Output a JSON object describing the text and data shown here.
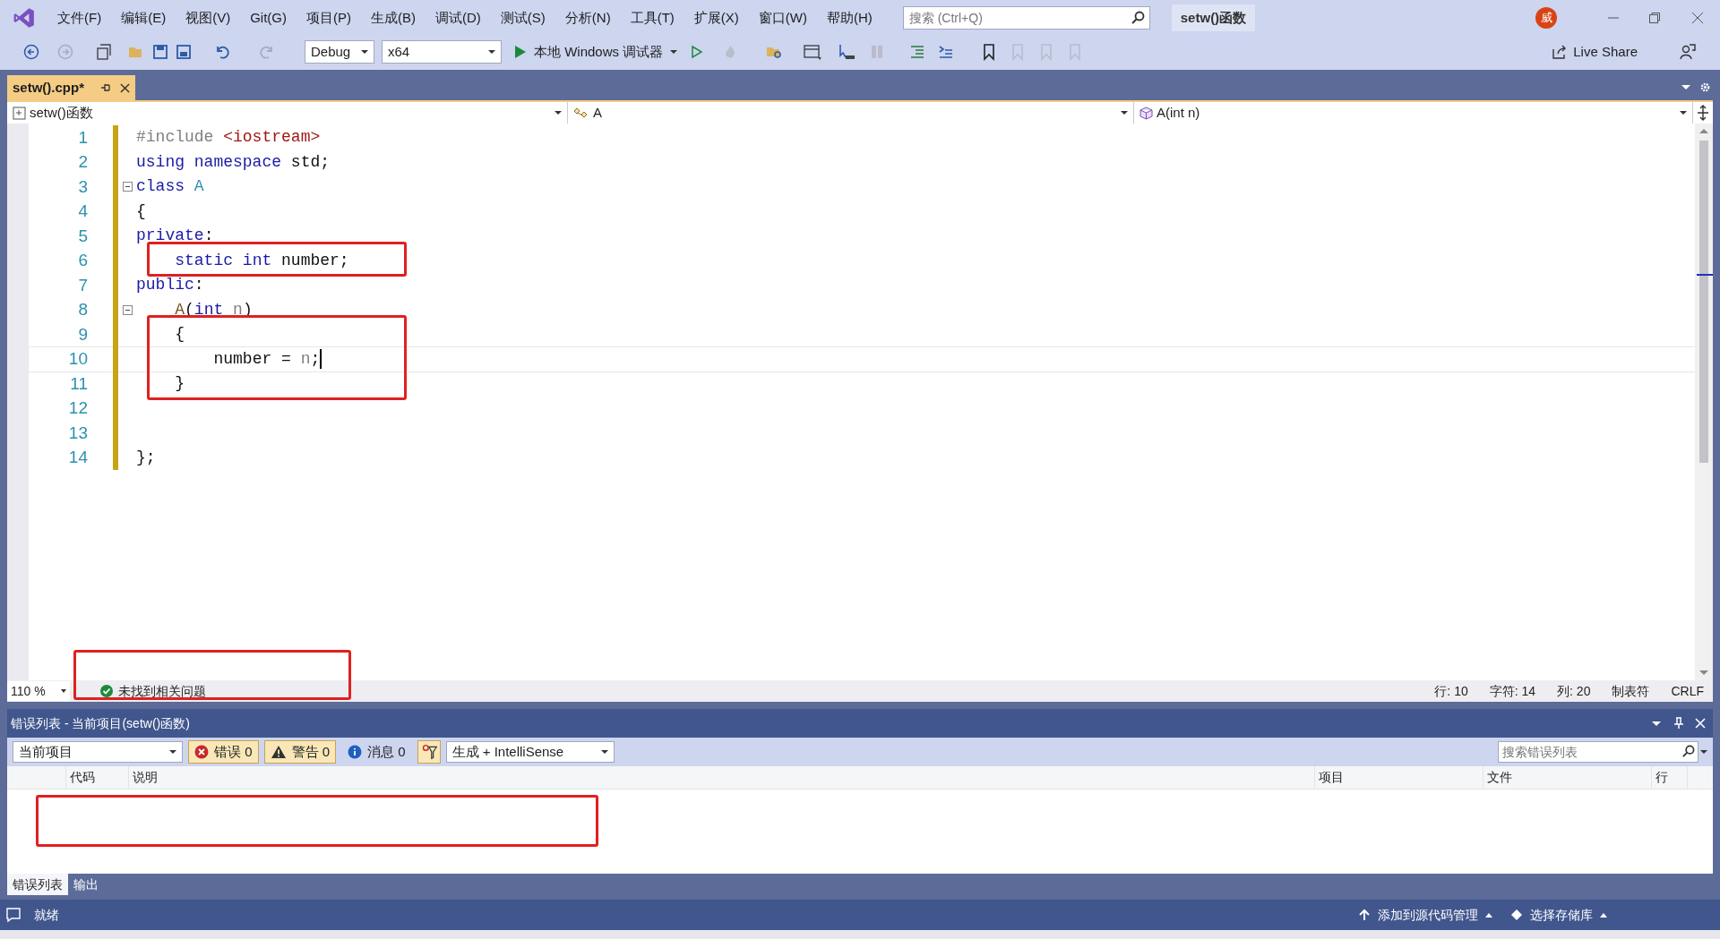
{
  "title_bar": {
    "menu": [
      "文件(F)",
      "编辑(E)",
      "视图(V)",
      "Git(G)",
      "项目(P)",
      "生成(B)",
      "调试(D)",
      "测试(S)",
      "分析(N)",
      "工具(T)",
      "扩展(X)",
      "窗口(W)",
      "帮助(H)"
    ],
    "search": {
      "placeholder": "搜索 (Ctrl+Q)"
    },
    "solution_name": "setw()函数",
    "avatar": "威"
  },
  "toolbar": {
    "configuration": "Debug",
    "platform": "x64",
    "run": "本地 Windows 调试器",
    "live_share": "Live Share"
  },
  "document_tabs": [
    {
      "label": "setw().cpp*",
      "selected": true
    }
  ],
  "nav_bar": [
    "setw()函数",
    "A",
    "A(int n)"
  ],
  "code_lines": [
    {
      "number": "1",
      "tokens": [
        {
          "kind": "preproc",
          "text": "#include "
        },
        {
          "kind": "string",
          "text": "<iostream>"
        }
      ]
    },
    {
      "number": "2",
      "tokens": [
        {
          "kind": "keyword",
          "text": "using namespace"
        },
        {
          "kind": "plain",
          "text": " std;"
        }
      ]
    },
    {
      "number": "3",
      "fold": true,
      "tokens": [
        {
          "kind": "keyword",
          "text": "class "
        },
        {
          "kind": "type",
          "text": "A"
        }
      ]
    },
    {
      "number": "4",
      "tokens": [
        {
          "kind": "plain",
          "text": "{"
        }
      ]
    },
    {
      "number": "5",
      "tokens": [
        {
          "kind": "keyword",
          "text": "private"
        },
        {
          "kind": "plain",
          "text": ":"
        }
      ]
    },
    {
      "number": "6",
      "marked": true,
      "tokens": [
        {
          "kind": "keyword",
          "text": "    static int"
        },
        {
          "kind": "plain",
          "text": " number;"
        }
      ]
    },
    {
      "number": "7",
      "tokens": [
        {
          "kind": "keyword",
          "text": "public"
        },
        {
          "kind": "plain",
          "text": ":"
        }
      ]
    },
    {
      "number": "8",
      "fold": true,
      "tokens": [
        {
          "kind": "function",
          "text": "    A"
        },
        {
          "kind": "plain",
          "text": "("
        },
        {
          "kind": "keyword",
          "text": "int "
        },
        {
          "kind": "param",
          "text": "n"
        },
        {
          "kind": "plain",
          "text": ")"
        }
      ]
    },
    {
      "number": "9",
      "marked": true,
      "tokens": [
        {
          "kind": "plain",
          "text": "    {"
        }
      ]
    },
    {
      "number": "10",
      "marked": true,
      "cursor": true,
      "tokens": [
        {
          "kind": "plain",
          "text": "        number = "
        },
        {
          "kind": "param",
          "text": "n"
        },
        {
          "kind": "plain",
          "text": ";"
        }
      ]
    },
    {
      "number": "11",
      "marked": true,
      "tokens": [
        {
          "kind": "plain",
          "text": "    }"
        }
      ]
    },
    {
      "number": "12"
    },
    {
      "number": "13"
    },
    {
      "number": "14",
      "tokens": [
        {
          "kind": "plain",
          "text": "};"
        }
      ]
    }
  ],
  "editor_status": {
    "zoom": "110 %",
    "issues": "未找到相关问题",
    "issues_marked": true,
    "line": "行: 10",
    "char": "字符: 14",
    "col": "列: 20",
    "tabs": "制表符",
    "eol": "CRLF"
  },
  "error_list": {
    "title": "错误列表 - 当前项目(setw()函数)",
    "scope": "当前项目",
    "filters": [
      {
        "kind": "error",
        "label": "错误 0",
        "on": true
      },
      {
        "kind": "warning",
        "label": "警告 0",
        "on": true
      },
      {
        "kind": "info",
        "label": "消息 0",
        "on": false
      }
    ],
    "source": "生成 + IntelliSense",
    "search": {
      "placeholder": "搜索错误列表"
    },
    "columns": [
      "代码",
      "说明",
      "项目",
      "文件",
      "行"
    ],
    "body_marked": true
  },
  "tool_tabs": [
    {
      "label": "错误列表",
      "selected": true
    },
    {
      "label": "输出",
      "selected": false
    }
  ],
  "status_bar": {
    "ready": "就绪",
    "source_control": "添加到源代码管理",
    "repository": "选择存储库"
  }
}
